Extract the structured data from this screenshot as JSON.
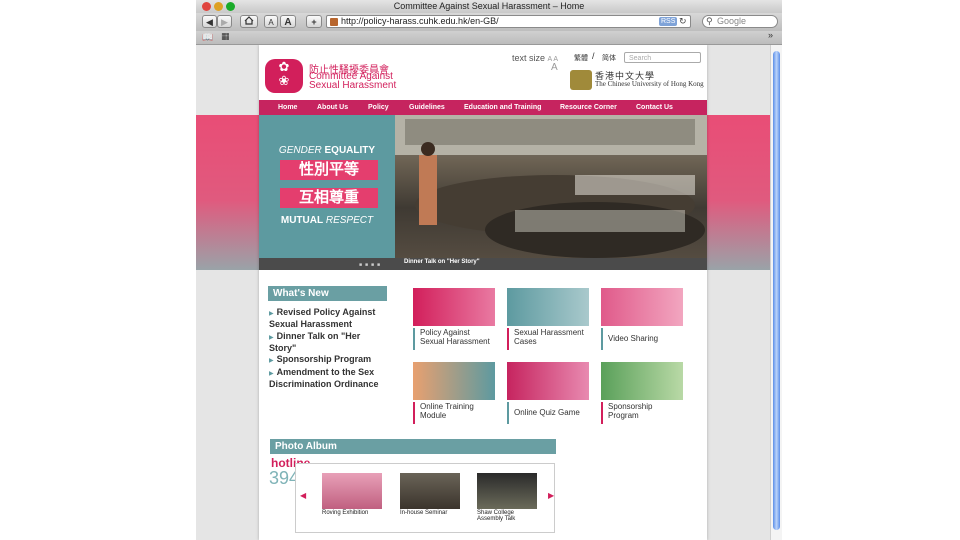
{
  "browser": {
    "window_title": "Committee Against Sexual Harassment – Home",
    "url": "http://policy-harass.cuhk.edu.hk/en-GB/",
    "rss": "RSS",
    "search_placeholder": "Google",
    "buttons": {
      "back": "◀",
      "forward": "▶",
      "font_small": "A",
      "font_large": "A",
      "add": "+"
    }
  },
  "header": {
    "org_name_cn": "防止性騷擾委員會",
    "org_name_en_line1": "Committee Against",
    "org_name_en_line2": "Sexual Harassment",
    "text_size_label": "text size",
    "text_size_a": "A A",
    "text_size_big": "A",
    "lang_traditional": "繁體",
    "lang_sep": "/",
    "lang_simplified": "简体",
    "search_placeholder": "Search",
    "cuhk_cn": "香港中文大學",
    "cuhk_en": "The Chinese University of Hong Kong"
  },
  "nav": [
    "Home",
    "About Us",
    "Policy",
    "Guidelines",
    "Education and Training",
    "Resource Corner",
    "Contact Us"
  ],
  "banner": {
    "gender": "GENDER",
    "equality": "EQUALITY",
    "cn1": "性別平等",
    "cn2": "互相尊重",
    "mutual": "MUTUAL",
    "respect": "RESPECT",
    "dots": "■■■■",
    "caption": "Dinner Talk on \"Her Story\""
  },
  "whats_new": {
    "title": "What's New",
    "items": [
      "Revised Policy Against Sexual Harassment",
      "Dinner Talk on \"Her Story\"",
      "Sponsorship Program",
      "Amendment to the Sex Discrimination Ordinance"
    ]
  },
  "tiles": [
    {
      "label": "Policy Against Sexual Harassment",
      "color": "#d21f5b"
    },
    {
      "label": "Sexual Harassment Cases",
      "color": "#5d9aa0"
    },
    {
      "label": "Video Sharing",
      "color": "#e05a8a"
    },
    {
      "label": "Online Training Module",
      "color": "#e8a070"
    },
    {
      "label": "Online Quiz Game",
      "color": "#c6245f"
    },
    {
      "label": "Sponsorship Program",
      "color": "#5aa05a"
    }
  ],
  "photo_album": {
    "title": "Photo Album",
    "hotline": "hotline",
    "hotline_number": "394",
    "prev": "◀",
    "next": "▶",
    "photos": [
      "Roving Exhibition",
      "In-house Seminar",
      "Shaw College Assembly Talk"
    ]
  }
}
